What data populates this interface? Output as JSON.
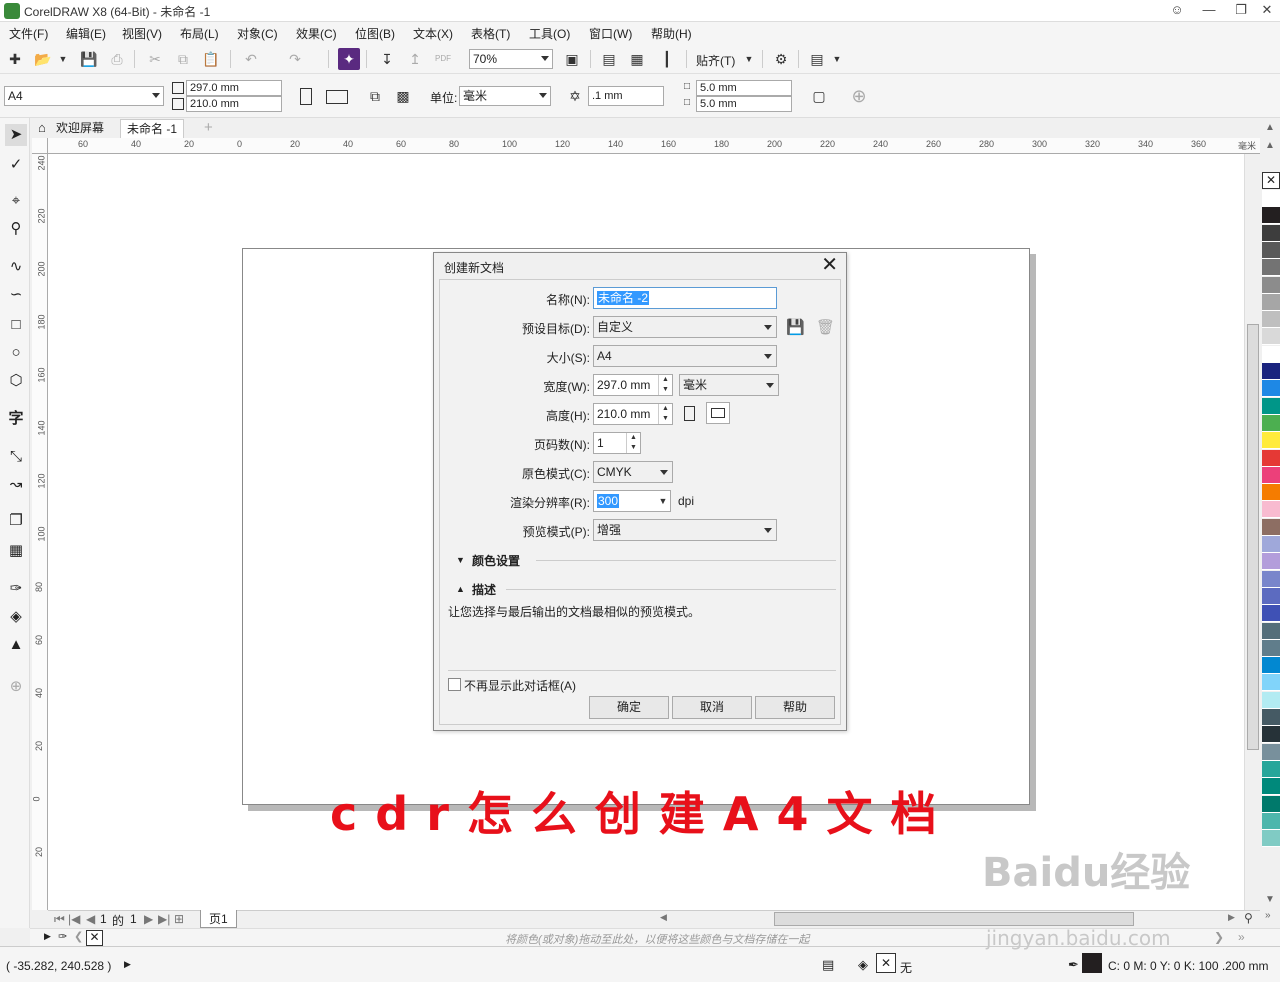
{
  "window": {
    "title": "CorelDRAW X8 (64-Bit) - 未命名 -1"
  },
  "menu": [
    "文件(F)",
    "编辑(E)",
    "视图(V)",
    "布局(L)",
    "对象(C)",
    "效果(C)",
    "位图(B)",
    "文本(X)",
    "表格(T)",
    "工具(O)",
    "窗口(W)",
    "帮助(H)"
  ],
  "toolbar": {
    "zoom": "70%",
    "snap_label": "贴齐(T)"
  },
  "propbar": {
    "page_size": "A4",
    "width": "297.0 mm",
    "height": "210.0 mm",
    "unit_label": "单位:",
    "unit": "毫米",
    "nudge": ".1 mm",
    "dup_x": "5.0 mm",
    "dup_y": "5.0 mm"
  },
  "tabs": {
    "welcome": "欢迎屏幕",
    "doc": "未命名 -1"
  },
  "ruler_h": [
    "60",
    "40",
    "20",
    "0",
    "20",
    "40",
    "60",
    "80",
    "100",
    "120",
    "140",
    "160",
    "180",
    "200",
    "220",
    "240",
    "260",
    "280",
    "300",
    "320",
    "340",
    "360"
  ],
  "ruler_h_unit": "毫米",
  "ruler_v": [
    "240",
    "220",
    "200",
    "180",
    "160",
    "140",
    "120",
    "100",
    "80",
    "60",
    "40",
    "20",
    "0",
    "20"
  ],
  "pagenav": {
    "current": "1",
    "of": "的",
    "total": "1",
    "page_tab": "页1"
  },
  "doc_palette_hint": "将颜色(或对象)拖动至此处，以便将这些颜色与文档存储在一起",
  "status": {
    "coords": "( -35.282, 240.528 )",
    "fill": "无",
    "outline": "C: 0 M: 0 Y: 0 K: 100  .200 mm"
  },
  "dialog": {
    "title": "创建新文档",
    "labels": {
      "name": "名称(N):",
      "preset": "预设目标(D):",
      "size": "大小(S):",
      "width": "宽度(W):",
      "height": "高度(H):",
      "pages": "页码数(N):",
      "color_mode": "原色模式(C):",
      "dpi": "渲染分辨率(R):",
      "preview": "预览模式(P):"
    },
    "values": {
      "name": "未命名 -2",
      "preset": "自定义",
      "size": "A4",
      "width": "297.0 mm",
      "unit": "毫米",
      "height": "210.0 mm",
      "pages": "1",
      "color_mode": "CMYK",
      "dpi": "300",
      "dpi_unit": "dpi",
      "preview": "增强"
    },
    "sections": {
      "color": "颜色设置",
      "desc": "描述"
    },
    "description": "让您选择与最后输出的文档最相似的预览模式。",
    "checkbox": "不再显示此对话框(A)",
    "buttons": {
      "ok": "确定",
      "cancel": "取消",
      "help": "帮助"
    }
  },
  "overlay": "cdr怎么创建A4文档",
  "watermark": {
    "main": "Baidu经验",
    "sub": "jingyan.baidu.com"
  },
  "palette_colors": [
    "#ffffff",
    "#231f20",
    "#3d3d3d",
    "#595959",
    "#737373",
    "#8c8c8c",
    "#a6a6a6",
    "#bfbfbf",
    "#d9d9d9",
    "#ffffff",
    "#1a237e",
    "#1e88e5",
    "#009688",
    "#4caf50",
    "#ffeb3b",
    "#e53935",
    "#ec407a",
    "#f57c00",
    "#f8bbd0",
    "#8d6e63",
    "#9fa8da",
    "#b39ddb",
    "#7986cb",
    "#5c6bc0",
    "#3f51b5",
    "#546e7a",
    "#607d8b",
    "#0288d1",
    "#81d4fa",
    "#b2ebf2",
    "#455a64",
    "#263238",
    "#78909c",
    "#26a69a",
    "#00897b",
    "#00796b",
    "#4db6ac",
    "#80cbc4"
  ]
}
